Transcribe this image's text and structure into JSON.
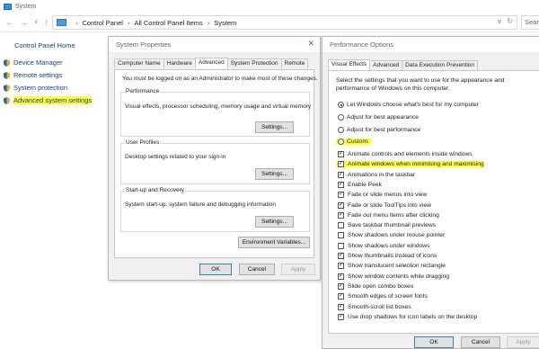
{
  "window": {
    "title": "System"
  },
  "address": {
    "crumbs": [
      "Control Panel",
      "All Control Panel Items",
      "System"
    ],
    "search_placeholder": "Search"
  },
  "left_pane": {
    "home": "Control Panel Home",
    "links": [
      "Device Manager",
      "Remote settings",
      "System protection",
      "Advanced system settings"
    ]
  },
  "sysprop": {
    "title": "System Properties",
    "tabs": [
      "Computer Name",
      "Hardware",
      "Advanced",
      "System Protection",
      "Remote"
    ],
    "admin_note": "You must be logged on as an Administrator to make most of these changes.",
    "perf_title": "Performance",
    "perf_desc": "Visual effects, processor scheduling, memory usage and virtual memory",
    "profiles_title": "User Profiles",
    "profiles_desc": "Desktop settings related to your sign-in",
    "startup_title": "Start-up and Recovery",
    "startup_desc": "System start-up, system failure and debugging information",
    "settings_label": "Settings...",
    "env_label": "Environment Variables...",
    "ok": "OK",
    "cancel": "Cancel",
    "apply": "Apply"
  },
  "perf": {
    "title": "Performance Options",
    "tabs": [
      "Visual Effects",
      "Advanced",
      "Data Execution Prevention"
    ],
    "intro": "Select the settings that you want to use for the appearance and performance of Windows on this computer.",
    "radios": [
      {
        "label": "Let Windows choose what's best for my computer",
        "selected": true
      },
      {
        "label": "Adjust for best appearance",
        "selected": false
      },
      {
        "label": "Adjust for best performance",
        "selected": false
      },
      {
        "label": "Custom:",
        "selected": false
      }
    ],
    "checks": [
      {
        "label": "Animate controls and elements inside windows",
        "checked": true
      },
      {
        "label": "Animate windows when minimising and maximising",
        "checked": true
      },
      {
        "label": "Animations in the taskbar",
        "checked": true
      },
      {
        "label": "Enable Peek",
        "checked": true
      },
      {
        "label": "Fade or slide menus into view",
        "checked": true
      },
      {
        "label": "Fade or slide ToolTips into view",
        "checked": true
      },
      {
        "label": "Fade out menu items after clicking",
        "checked": true
      },
      {
        "label": "Save taskbar thumbnail previews",
        "checked": false
      },
      {
        "label": "Show shadows under mouse pointer",
        "checked": false
      },
      {
        "label": "Show shadows under windows",
        "checked": false
      },
      {
        "label": "Show thumbnails instead of icons",
        "checked": true
      },
      {
        "label": "Show translucent selection rectangle",
        "checked": true
      },
      {
        "label": "Show window contents while dragging",
        "checked": true
      },
      {
        "label": "Slide open combo boxes",
        "checked": true
      },
      {
        "label": "Smooth edges of screen fonts",
        "checked": true
      },
      {
        "label": "Smooth-scroll list boxes",
        "checked": true
      },
      {
        "label": "Use drop shadows for icon labels on the desktop",
        "checked": true
      }
    ],
    "ok": "OK",
    "cancel": "Cancel",
    "apply": "Apply"
  },
  "colors": {
    "highlight": "#ffff36",
    "link": "#1a3e8c"
  }
}
